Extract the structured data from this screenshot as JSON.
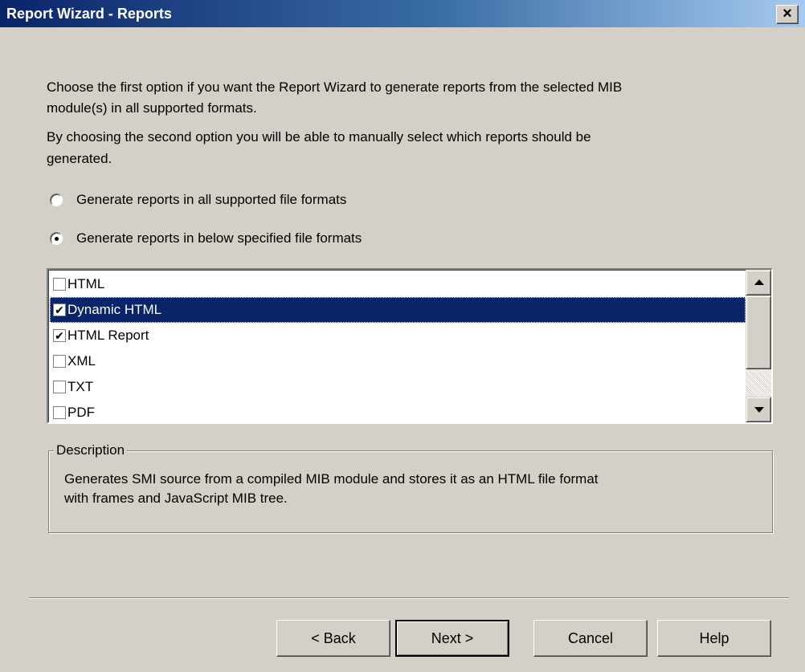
{
  "window": {
    "title": "Report Wizard - Reports",
    "close_glyph": "×"
  },
  "intro": {
    "line1": "Choose the first option if you want the Report Wizard to generate reports from the selected MIB",
    "line2": "module(s) in all supported formats.",
    "line3": "By choosing the second option you will be able to manually select which reports should be",
    "line4": "generated."
  },
  "options": {
    "all_formats": {
      "label": "Generate reports in all supported file formats",
      "checked": false
    },
    "specified_formats": {
      "label": "Generate reports in below specified file formats",
      "checked": true
    }
  },
  "formats": {
    "items": [
      {
        "label": "HTML",
        "checked": false,
        "selected": false
      },
      {
        "label": "Dynamic HTML",
        "checked": true,
        "selected": true
      },
      {
        "label": "HTML Report",
        "checked": true,
        "selected": false
      },
      {
        "label": "XML",
        "checked": false,
        "selected": false
      },
      {
        "label": "TXT",
        "checked": false,
        "selected": false
      },
      {
        "label": "PDF",
        "checked": false,
        "selected": false
      }
    ]
  },
  "description": {
    "legend": "Description",
    "line1": "Generates SMI source from a compiled MIB module and stores it as an HTML file format",
    "line2": "with frames and JavaScript MIB tree."
  },
  "buttons": {
    "back": "< Back",
    "next": "Next >",
    "cancel": "Cancel",
    "help": "Help"
  },
  "icons": {
    "checkmark": "✔"
  }
}
